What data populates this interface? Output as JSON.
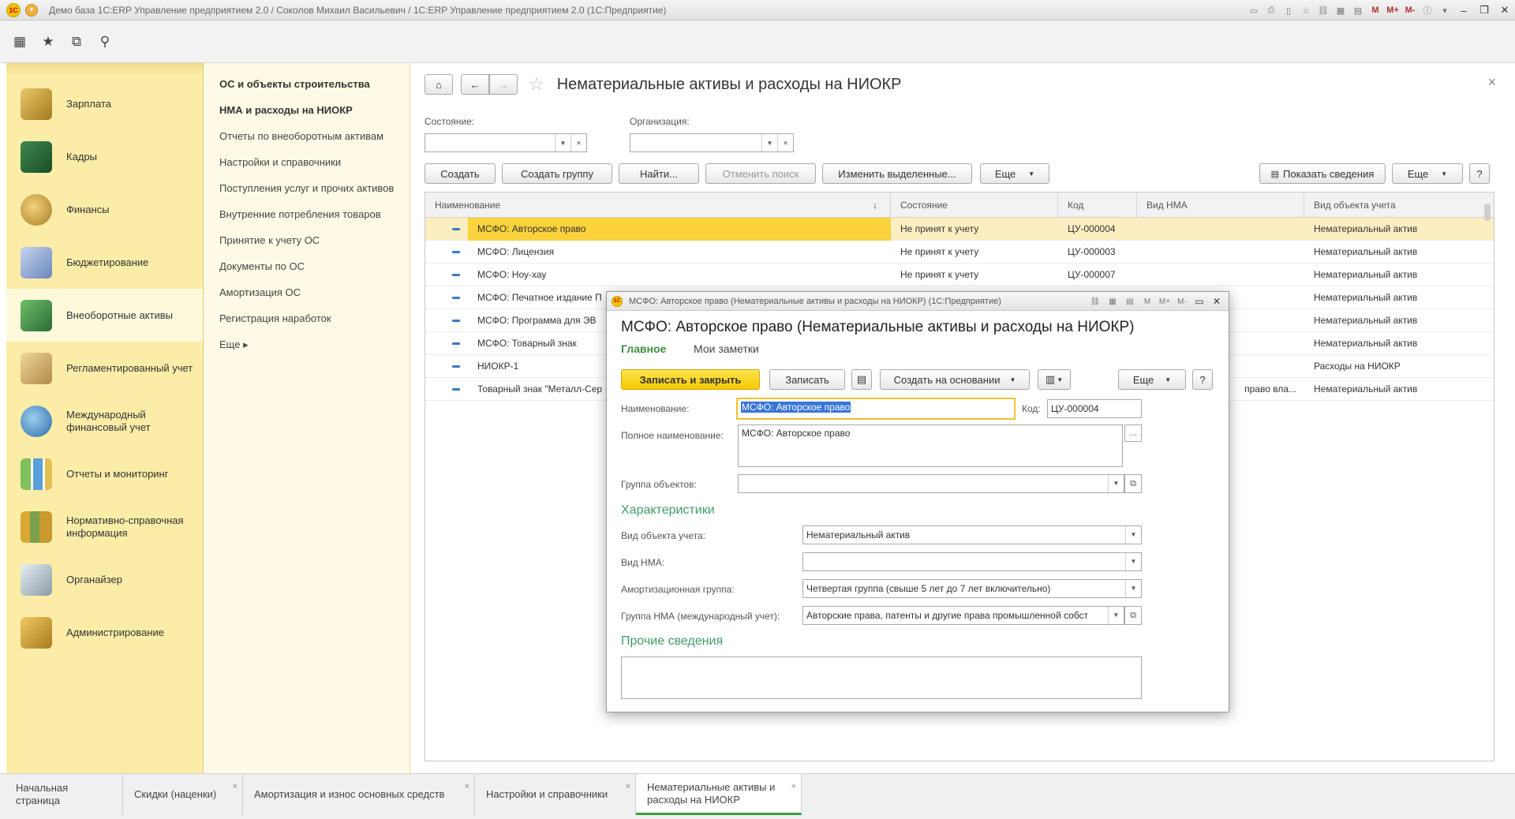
{
  "window": {
    "title": "Демо база 1С:ERP Управление предприятием 2.0 / Соколов Михаил Васильевич / 1С:ERP Управление предприятием 2.0  (1С:Предприятие)",
    "tools": [
      "M",
      "M+",
      "M-"
    ]
  },
  "sections": [
    {
      "label": "Зарплата",
      "color": "#c9a33a"
    },
    {
      "label": "Кадры",
      "color": "#2d6b3a"
    },
    {
      "label": "Финансы",
      "color": "#c8a040"
    },
    {
      "label": "Бюджетирование",
      "color": "#7a96c8"
    },
    {
      "label": "Внеоборотные активы",
      "color": "#3b8a4a",
      "active": true
    },
    {
      "label": "Регламентированный учет",
      "color": "#c7a35a"
    },
    {
      "label": "Международный финансовый учет",
      "color": "#5a9ad0"
    },
    {
      "label": "Отчеты и мониторинг",
      "color": "#6aaa4a"
    },
    {
      "label": "Нормативно-справочная информация",
      "color": "#c89a30"
    },
    {
      "label": "Органайзер",
      "color": "#8a9aa8"
    },
    {
      "label": "Администрирование",
      "color": "#d8a030"
    }
  ],
  "nav": {
    "links": [
      {
        "label": "ОС и объекты строительства",
        "bold": true
      },
      {
        "label": "НМА и расходы на НИОКР",
        "bold": true
      },
      {
        "label": "Отчеты по внеоборотным активам"
      },
      {
        "label": "Настройки и справочники"
      },
      {
        "label": "Поступления услуг и прочих активов"
      },
      {
        "label": "Внутренние потребления товаров"
      },
      {
        "label": "Принятие к учету ОС"
      },
      {
        "label": "Документы по ОС"
      },
      {
        "label": "Амортизация ОС"
      },
      {
        "label": "Регистрация наработок"
      },
      {
        "label": "Еще ▸"
      }
    ]
  },
  "main": {
    "title": "Нематериальные активы и расходы на НИОКР",
    "filters": {
      "state_label": "Состояние:",
      "org_label": "Организация:"
    },
    "buttons": {
      "create": "Создать",
      "create_group": "Создать группу",
      "find": "Найти...",
      "cancel_search": "Отменить поиск",
      "edit_selected": "Изменить выделенные...",
      "more": "Еще",
      "show_info": "Показать сведения",
      "more2": "Еще",
      "help": "?"
    },
    "columns": [
      "Наименование",
      "Состояние",
      "Код",
      "Вид НМА",
      "Вид объекта учета"
    ],
    "rows": [
      {
        "name": "МСФО: Авторское право",
        "state": "Не принят к учету",
        "code": "ЦУ-000004",
        "kind": "",
        "object": "Нематериальный актив"
      },
      {
        "name": "МСФО: Лицензия",
        "state": "Не принят к учету",
        "code": "ЦУ-000003",
        "kind": "",
        "object": "Нематериальный актив"
      },
      {
        "name": "МСФО: Ноу-хау",
        "state": "Не принят к учету",
        "code": "ЦУ-000007",
        "kind": "",
        "object": "Нематериальный актив"
      },
      {
        "name": "МСФО: Печатное издание П",
        "state": "",
        "code": "",
        "kind": "",
        "object": "Нематериальный актив"
      },
      {
        "name": "МСФО: Программа для ЭВ",
        "state": "",
        "code": "",
        "kind": "",
        "object": "Нематериальный актив"
      },
      {
        "name": "МСФО: Товарный знак",
        "state": "",
        "code": "",
        "kind": "",
        "object": "Нематериальный актив"
      },
      {
        "name": "НИОКР-1",
        "state": "",
        "code": "",
        "kind": "",
        "object": "Расходы на НИОКР"
      },
      {
        "name": "Товарный знак \"Металл-Сер",
        "state": "",
        "code": "",
        "kind": "право вла...",
        "object": "Нематериальный актив"
      }
    ]
  },
  "modal": {
    "window_title": "МСФО: Авторское право (Нематериальные активы и расходы на НИОКР)  (1С:Предприятие)",
    "heading": "МСФО: Авторское право (Нематериальные активы и расходы на НИОКР)",
    "tab_main": "Главное",
    "tab_notes": "Мои заметки",
    "buttons": {
      "save_close": "Записать и закрыть",
      "save": "Записать",
      "create_based": "Создать на основании",
      "more": "Еще",
      "help": "?"
    },
    "fields": {
      "name_label": "Наименование:",
      "name_value": "МСФО: Авторское право",
      "code_label": "Код:",
      "code_value": "ЦУ-000004",
      "fullname_label": "Полное наименование:",
      "fullname_value": "МСФО: Авторское право",
      "group_label": "Группа объектов:"
    },
    "characteristics": {
      "title": "Характеристики",
      "object_kind_label": "Вид объекта учета:",
      "object_kind_value": "Нематериальный актив",
      "nma_kind_label": "Вид НМА:",
      "nma_kind_value": "",
      "amort_label": "Амортизационная группа:",
      "amort_value": "Четвертая группа (свыше 5 лет до 7 лет включительно)",
      "intl_group_label": "Группа НМА (международный учет):",
      "intl_group_value": "Авторские права, патенты и другие права промышленной собст"
    },
    "other_title": "Прочие сведения"
  },
  "tabs": [
    {
      "label": "Начальная страница"
    },
    {
      "label": "Скидки (наценки)"
    },
    {
      "label": "Амортизация и износ основных средств"
    },
    {
      "label": "Настройки и справочники"
    },
    {
      "label": "Нематериальные активы и расходы на НИОКР",
      "active": true
    }
  ]
}
